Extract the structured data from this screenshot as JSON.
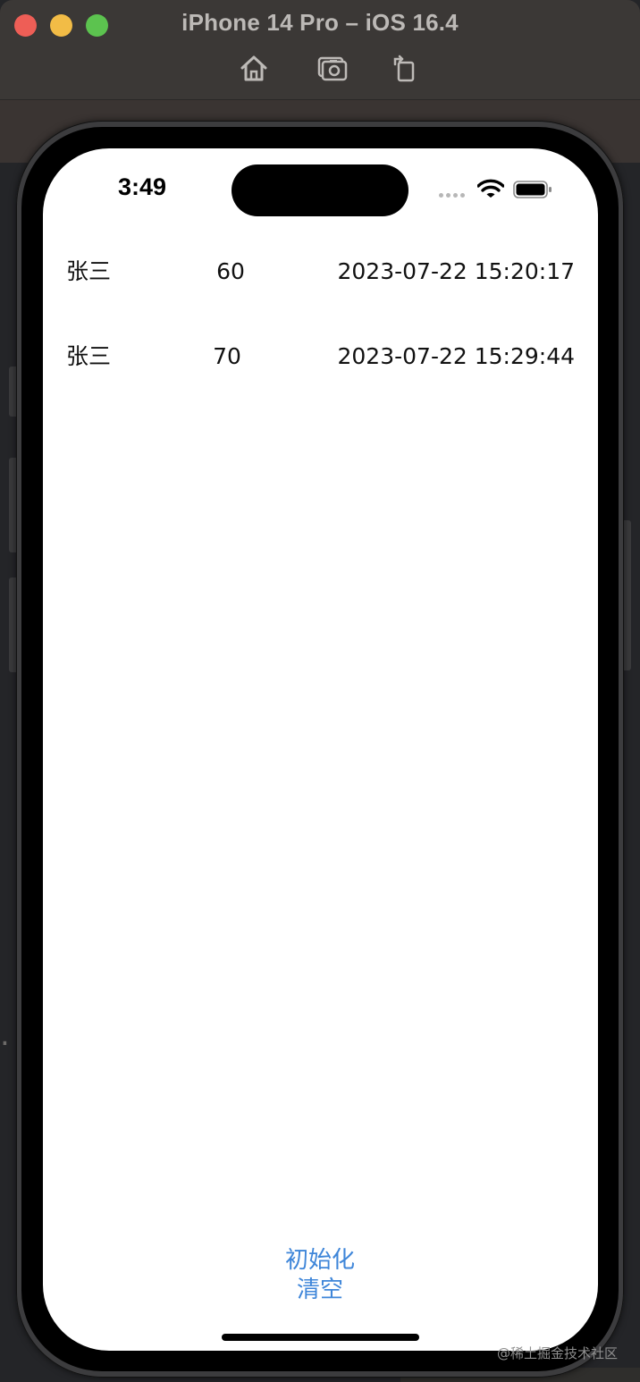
{
  "window": {
    "title": "iPhone 14 Pro – iOS 16.4",
    "toolbar": {
      "home_icon": "home-icon",
      "screenshot_icon": "screenshot-icon",
      "rotate_icon": "rotate-icon"
    }
  },
  "status_bar": {
    "time": "3:49",
    "icons": [
      "cellular-signal-icon",
      "wifi-icon",
      "battery-icon"
    ]
  },
  "list": {
    "rows": [
      {
        "name": "张三",
        "score": "60",
        "time": "2023-07-22 15:20:17"
      },
      {
        "name": "张三",
        "score": "70",
        "time": "2023-07-22 15:29:44"
      }
    ]
  },
  "actions": {
    "init_label": "初始化",
    "clear_label": "清空"
  },
  "colors": {
    "button_text": "#3f86d9",
    "titlebar": "#3b3836"
  },
  "watermark": {
    "text": "@稀土掘金技术社区"
  }
}
